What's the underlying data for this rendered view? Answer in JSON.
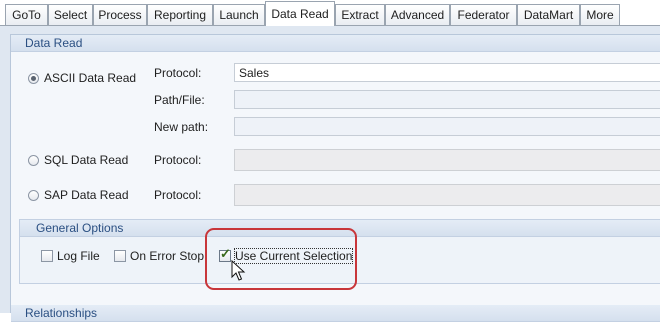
{
  "tabs": [
    {
      "label": "GoTo"
    },
    {
      "label": "Select"
    },
    {
      "label": "Process"
    },
    {
      "label": "Reporting"
    },
    {
      "label": "Launch"
    },
    {
      "label": "Data Read",
      "active": true
    },
    {
      "label": "Extract"
    },
    {
      "label": "Advanced"
    },
    {
      "label": "Federator"
    },
    {
      "label": "DataMart"
    },
    {
      "label": "More"
    }
  ],
  "data_read": {
    "title": "Data Read",
    "ascii": {
      "label": "ASCII Data Read",
      "selected": true,
      "protocol_label": "Protocol:",
      "protocol_value": "Sales",
      "path_label": "Path/File:",
      "path_value": "",
      "newpath_label": "New path:",
      "newpath_value": ""
    },
    "sql": {
      "label": "SQL Data Read",
      "selected": false,
      "protocol_label": "Protocol:",
      "protocol_value": ""
    },
    "sap": {
      "label": "SAP Data Read",
      "selected": false,
      "protocol_label": "Protocol:",
      "protocol_value": ""
    }
  },
  "general_options": {
    "title": "General Options",
    "log_file": {
      "label": "Log File",
      "checked": false
    },
    "on_error_stop": {
      "label": "On Error Stop",
      "checked": false
    },
    "use_current_selection": {
      "label": "Use Current Selection",
      "checked": true
    }
  },
  "relationships": {
    "title": "Relationships"
  },
  "colors": {
    "highlight": "#c8363a",
    "section_title": "#2a4f82",
    "checkmark": "#3a6a1c"
  }
}
